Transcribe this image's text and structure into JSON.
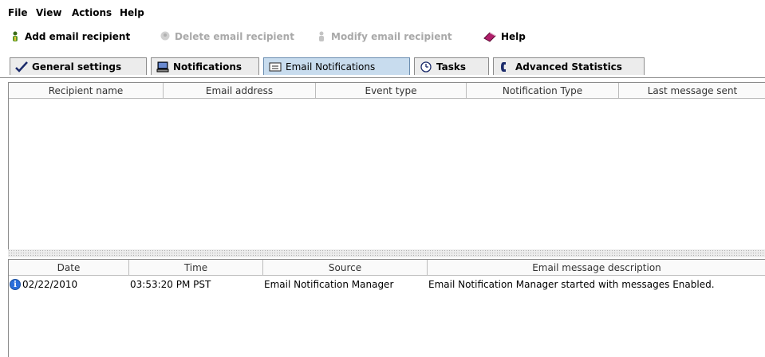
{
  "menubar": {
    "items": [
      {
        "label": "File"
      },
      {
        "label": "View"
      },
      {
        "label": "Actions"
      },
      {
        "label": "Help"
      }
    ]
  },
  "toolbar": {
    "add_recipient": "Add email recipient",
    "delete_recipient": "Delete email recipient",
    "modify_recipient": "Modify email recipient",
    "help": "Help"
  },
  "tabs": [
    {
      "label": "General settings",
      "icon": "check-icon"
    },
    {
      "label": "Notifications",
      "icon": "computer-icon"
    },
    {
      "label": "Email Notifications",
      "icon": "email-icon",
      "selected": true
    },
    {
      "label": "Tasks",
      "icon": "clock-icon"
    },
    {
      "label": "Advanced Statistics",
      "icon": "phone-icon"
    }
  ],
  "recipients_table": {
    "columns": [
      "Recipient name",
      "Email address",
      "Event type",
      "Notification Type",
      "Last message sent"
    ],
    "rows": []
  },
  "log_table": {
    "columns": [
      "Date",
      "Time",
      "Source",
      "Email message description"
    ],
    "rows": [
      {
        "icon": "info-icon",
        "date": "02/22/2010",
        "time": "03:53:20 PM PST",
        "source": "Email Notification Manager",
        "description": "Email Notification Manager started with messages Enabled."
      }
    ]
  },
  "colors": {
    "selected_tab": "#c8dcee",
    "disabled_text": "#a9a9a9",
    "info_icon": "#2a6edb"
  }
}
